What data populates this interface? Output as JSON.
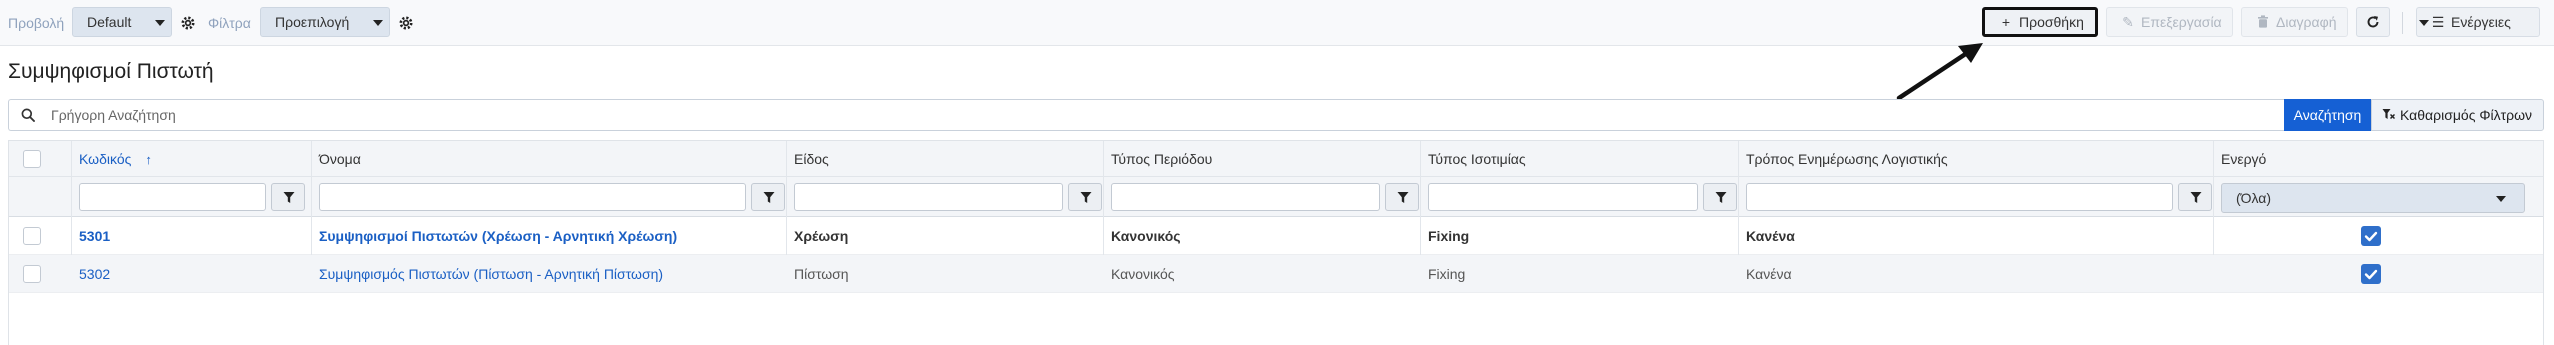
{
  "toolbar": {
    "view_label": "Προβολή",
    "view_value": "Default",
    "filters_label": "Φίλτρα",
    "filters_value": "Προεπιλογή",
    "add_label": "Προσθήκη",
    "edit_label": "Επεξεργασία",
    "delete_label": "Διαγραφή",
    "actions_label": "Ενέργειες"
  },
  "page": {
    "title": "Συμψηφισμοί Πιστωτή"
  },
  "search": {
    "placeholder": "Γρήγορη Αναζήτηση",
    "search_button": "Αναζήτηση",
    "clear_button": "Καθαρισμός Φίλτρων"
  },
  "table": {
    "columns": [
      "Κωδικός",
      "Όνομα",
      "Είδος",
      "Τύπος Περιόδου",
      "Τύπος Ισοτιμίας",
      "Τρόπος Ενημέρωσης Λογιστικής",
      "Ενεργό"
    ],
    "sort_column": "Κωδικός",
    "sort_direction": "ascending",
    "active_filter_value": "(Όλα)",
    "rows": [
      {
        "code": "5301",
        "name": "Συμψηφισμοί Πιστωτών (Χρέωση - Αρνητική Χρέωση)",
        "kind": "Χρέωση",
        "period_type": "Κανονικός",
        "rate_type": "Fixing",
        "accounting_update": "Κανένα",
        "active": true
      },
      {
        "code": "5302",
        "name": "Συμψηφισμός Πιστωτών (Πίστωση - Αρνητική Πίστωση)",
        "kind": "Πίστωση",
        "period_type": "Κανονικός",
        "rate_type": "Fixing",
        "accounting_update": "Κανένα",
        "active": true
      }
    ]
  },
  "colors": {
    "primary": "#1560d4",
    "link": "#1a5fc4",
    "checkbox_checked": "#2f6fca",
    "header_bg": "#f3f5f8"
  }
}
